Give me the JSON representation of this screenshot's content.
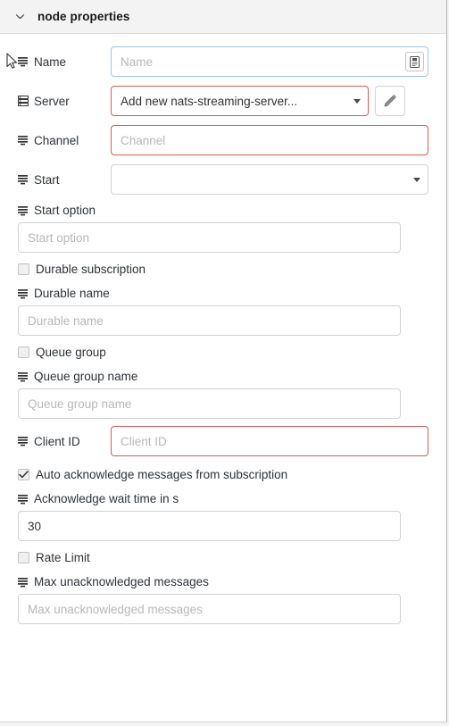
{
  "header": {
    "title": "node properties",
    "collapse_icon": "chevron-down-icon"
  },
  "fields": {
    "name": {
      "label": "Name",
      "icon": "bars-icon",
      "placeholder": "Name",
      "value": "",
      "type_button_icon": "tag-icon",
      "state": "focused"
    },
    "server": {
      "label": "Server",
      "icon": "server-icon",
      "selected": "Add new nats-streaming-server...",
      "state": "error",
      "edit_button_icon": "pencil-icon"
    },
    "channel": {
      "label": "Channel",
      "icon": "bars-icon",
      "placeholder": "Channel",
      "value": "",
      "state": "error"
    },
    "start": {
      "label": "Start",
      "icon": "bars-icon",
      "selected": "",
      "state": "normal"
    },
    "start_option": {
      "label": "Start option",
      "icon": "bars-icon",
      "placeholder": "Start option",
      "value": ""
    },
    "durable_subscription": {
      "label": "Durable subscription",
      "checked": false
    },
    "durable_name": {
      "label": "Durable name",
      "icon": "bars-icon",
      "placeholder": "Durable name",
      "value": ""
    },
    "queue_group": {
      "label": "Queue group",
      "checked": false
    },
    "queue_group_name": {
      "label": "Queue group name",
      "icon": "bars-icon",
      "placeholder": "Queue group name",
      "value": ""
    },
    "client_id": {
      "label": "Client ID",
      "icon": "bars-icon",
      "placeholder": "Client ID",
      "value": "",
      "state": "error"
    },
    "auto_acknowledge": {
      "label": "Auto acknowledge messages from subscription",
      "checked": true
    },
    "ack_wait_time": {
      "label": "Acknowledge wait time in s",
      "icon": "bars-icon",
      "placeholder": "",
      "value": "30"
    },
    "rate_limit": {
      "label": "Rate Limit",
      "checked": false
    },
    "max_unacknowledged": {
      "label": "Max unacknowledged messages",
      "icon": "bars-icon",
      "placeholder": "Max unacknowledged messages",
      "value": ""
    }
  },
  "colors": {
    "error_border": "#d15c5c",
    "focus_border": "#9dc6e8",
    "panel_bg": "#ffffff",
    "header_bg": "#f3f3f3",
    "text": "#2e3338",
    "placeholder": "#b8b8b8"
  }
}
